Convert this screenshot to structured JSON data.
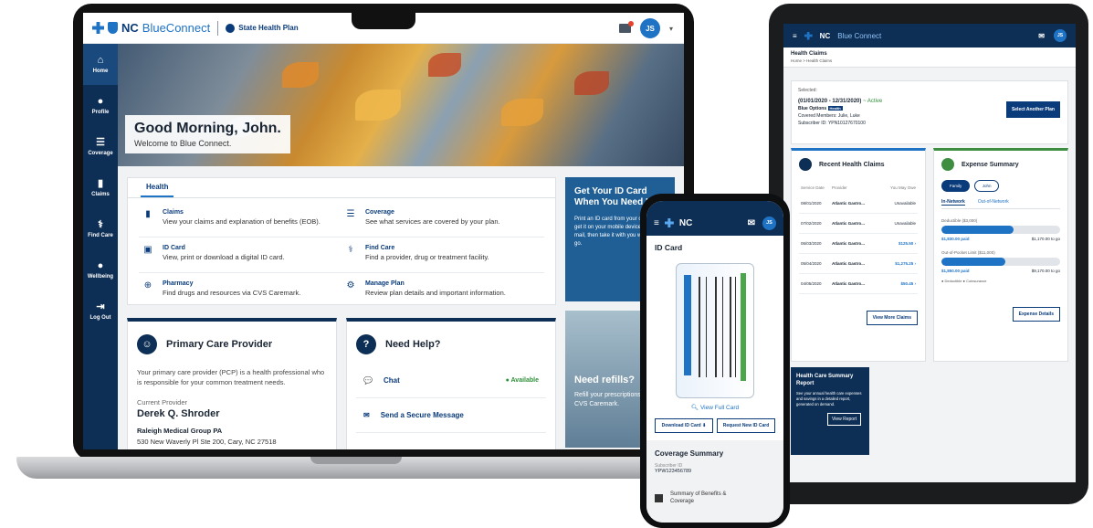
{
  "laptop": {
    "brand": {
      "nc": "NC",
      "blueconnect": "BlueConnect",
      "plan": "State Health Plan"
    },
    "user_initials": "JS",
    "nav": [
      {
        "label": "Home",
        "icon": "home-icon",
        "glyph": "⌂"
      },
      {
        "label": "Profile",
        "icon": "person-icon",
        "glyph": "👤"
      },
      {
        "label": "Coverage",
        "icon": "list-icon",
        "glyph": "☰"
      },
      {
        "label": "Claims",
        "icon": "document-icon",
        "glyph": "▮"
      },
      {
        "label": "Find Care",
        "icon": "caduceus-icon",
        "glyph": "⚕"
      },
      {
        "label": "Wellbeing",
        "icon": "apple-icon",
        "glyph": "●"
      },
      {
        "label": "Log Out",
        "icon": "logout-icon",
        "glyph": "⇥"
      }
    ],
    "greeting": {
      "title": "Good Morning, John.",
      "subtitle": "Welcome to Blue Connect."
    },
    "health_tab": "Health",
    "health_items": [
      {
        "title": "Claims",
        "desc": "View your claims and explanation of benefits (EOB).",
        "glyph": "▮"
      },
      {
        "title": "Coverage",
        "desc": "See what services are covered by your plan.",
        "glyph": "☰"
      },
      {
        "title": "ID Card",
        "desc": "View, print or download a digital ID card.",
        "glyph": "▣"
      },
      {
        "title": "Find Care",
        "desc": "Find a provider, drug or treatment facility.",
        "glyph": "⚕"
      },
      {
        "title": "Pharmacy",
        "desc": "Find drugs and resources via CVS Caremark.",
        "glyph": "⊕"
      },
      {
        "title": "Manage Plan",
        "desc": "Review plan details and important information.",
        "glyph": "⚙"
      }
    ],
    "id_promo": {
      "title": "Get Your ID Card When You Need It",
      "desc": "Print an ID card from your computer, get it on your mobile device or in the mail, then take it with you when you go."
    },
    "refill": {
      "title": "Need refills?",
      "desc": "Refill your prescriptions with CVS Caremark."
    },
    "pcp": {
      "title": "Primary Care Provider",
      "desc": "Your primary care provider (PCP) is a health professional who is responsible for your common treatment needs.",
      "current_label": "Current Provider",
      "doctor": "Derek Q. Shroder",
      "org": "Raleigh Medical Group PA",
      "address": "530 New Waverly Pl Ste 200, Cary, NC 27518"
    },
    "help": {
      "title": "Need Help?",
      "chat": "Chat",
      "chat_status": "Available",
      "message": "Send a Secure Message"
    }
  },
  "tablet": {
    "brand": {
      "nc": "NC",
      "blueconnect": "Blue Connect"
    },
    "user_initials": "JS",
    "page_title": "Health Claims",
    "breadcrumb": "Home  >  Health Claims",
    "plan": {
      "selected": "Selected:",
      "dates": "(01/01/2020 - 12/31/2020)",
      "status": "~ Active",
      "name": "Blue Options",
      "badge": "Health",
      "members": "Covered Members: Julie, Luke",
      "subscriber": "Subscriber ID: YPN10127670100",
      "button": "Select Another Plan"
    },
    "claims": {
      "title": "Recent Health Claims",
      "headers": [
        "Service Date",
        "Provider",
        "You May Owe"
      ],
      "rows": [
        [
          "08/01/2020",
          "Atlantic Gastro...",
          "Unavailable"
        ],
        [
          "07/02/2020",
          "Atlantic Gastro...",
          "Unavailable"
        ],
        [
          "06/03/2020",
          "Atlantic Gastro...",
          "$125.50  ›"
        ],
        [
          "05/04/2020",
          "Atlantic Gastro...",
          "$1,275.25  ›"
        ],
        [
          "04/05/2020",
          "Atlantic Gastro...",
          "$50.45  ›"
        ]
      ],
      "button": "View More Claims"
    },
    "expense": {
      "title": "Expense Summary",
      "family": "Family",
      "john": "John",
      "in_network": "In-Network",
      "out_network": "Out-of-Network",
      "deductible_label": "Deductible ($3,000)",
      "deductible_paid": "$1,830.00 paid",
      "deductible_togo": "$1,170.00 to go",
      "deductible_fraction": 0.61,
      "oop_label": "Out-of-Pocket Limit ($11,000)",
      "oop_paid": "$1,850.00 paid",
      "oop_togo": "$9,170.00 to go",
      "oop_fraction": 0.54,
      "legend": "●  Deductible     ●  Coinsurance",
      "button": "Expense Details"
    },
    "report": {
      "title": "Health Care Summary Report",
      "desc": "See your annual health care expenses and savings in a detailed report, generated on demand.",
      "button": "View Report"
    }
  },
  "phone": {
    "brand": "NC",
    "user_initials": "JS",
    "title": "ID Card",
    "view_full": "View Full Card",
    "download": "Download ID Card",
    "request": "Request New ID Card",
    "coverage_title": "Coverage Summary",
    "subscriber_label": "Subscriber ID",
    "subscriber_value": "YPW123456789",
    "sbc": "Summary of Benefits & Coverage"
  }
}
